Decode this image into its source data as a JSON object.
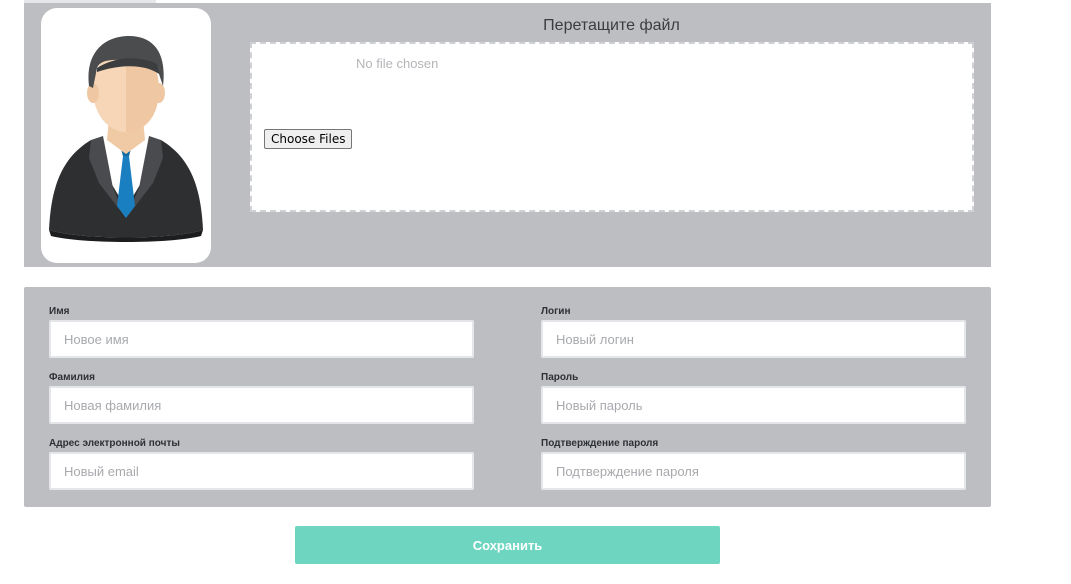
{
  "upload": {
    "title": "Перетащите файл",
    "no_file_text": "No file chosen",
    "choose_button": "Choose Files"
  },
  "avatar": {
    "icon": "businessman-avatar-icon"
  },
  "form": {
    "first_name": {
      "label": "Имя",
      "placeholder": "Новое имя"
    },
    "last_name": {
      "label": "Фамилия",
      "placeholder": "Новая фамилия"
    },
    "email": {
      "label": "Адрес электронной почты",
      "placeholder": "Новый email"
    },
    "login": {
      "label": "Логин",
      "placeholder": "Новый логин"
    },
    "password": {
      "label": "Пароль",
      "placeholder": "Новый пароль"
    },
    "password_confirm": {
      "label": "Подтверждение пароля",
      "placeholder": "Подтверждение пароля"
    }
  },
  "actions": {
    "save_label": "Сохранить"
  },
  "colors": {
    "panel": "#bdbec1",
    "accent": "#6dd5c0"
  }
}
